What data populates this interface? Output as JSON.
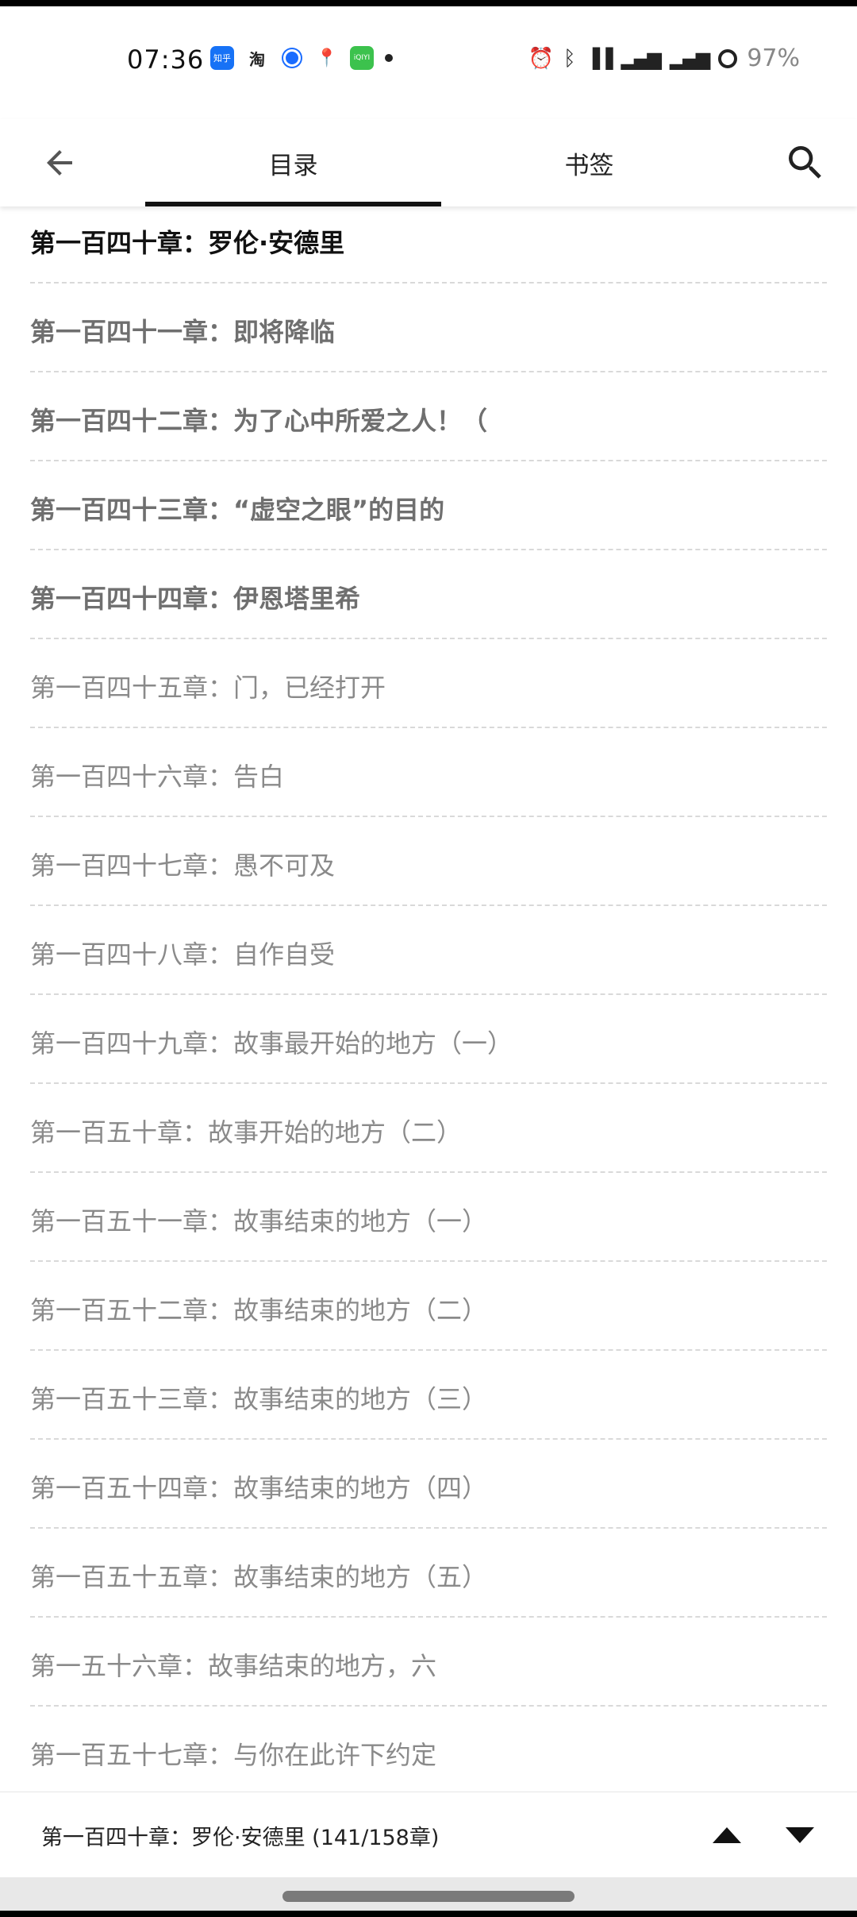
{
  "status_bar": {
    "time": "07:36",
    "notification_icons": [
      "zhihu-icon",
      "taobao-icon",
      "blue-circle-app-icon",
      "map-pin-icon",
      "iqiyi-icon"
    ],
    "zhihu_label": "知乎",
    "taobao_label": "淘",
    "iqiyi_label": "iQIYI",
    "battery": "97%"
  },
  "header": {
    "tabs": [
      {
        "label": "目录",
        "active": true
      },
      {
        "label": "书签",
        "active": false
      }
    ]
  },
  "chapters": [
    {
      "title": "第一百四十章：罗伦·安德里",
      "state": "current"
    },
    {
      "title": "第一百四十一章：即将降临",
      "state": "read"
    },
    {
      "title": "第一百四十二章：为了心中所爱之人！（",
      "state": "read"
    },
    {
      "title": "第一百四十三章：“虚空之眼”的目的",
      "state": "read"
    },
    {
      "title": "第一百四十四章：伊恩塔里希",
      "state": "read"
    },
    {
      "title": "第一百四十五章：门，已经打开",
      "state": "unread"
    },
    {
      "title": "第一百四十六章：告白",
      "state": "unread"
    },
    {
      "title": "第一百四十七章：愚不可及",
      "state": "unread"
    },
    {
      "title": "第一百四十八章：自作自受",
      "state": "unread"
    },
    {
      "title": "第一百四十九章：故事最开始的地方（一）",
      "state": "unread"
    },
    {
      "title": "第一百五十章：故事开始的地方（二）",
      "state": "unread"
    },
    {
      "title": "第一百五十一章：故事结束的地方（一）",
      "state": "unread"
    },
    {
      "title": "第一百五十二章：故事结束的地方（二）",
      "state": "unread"
    },
    {
      "title": "第一百五十三章：故事结束的地方（三）",
      "state": "unread"
    },
    {
      "title": "第一百五十四章：故事结束的地方（四）",
      "state": "unread"
    },
    {
      "title": "第一百五十五章：故事结束的地方（五）",
      "state": "unread"
    },
    {
      "title": "第一五十六章：故事结束的地方，六",
      "state": "unread"
    },
    {
      "title": "第一百五十七章：与你在此许下约定",
      "state": "unread"
    }
  ],
  "footer": {
    "current_chapter": "第一百四十章：罗伦·安德里 (141/158章)"
  },
  "colors": {
    "current_text": "#111111",
    "read_text": "#6f6f6f",
    "unread_text": "#8a8a8a",
    "divider": "#d9d9d9"
  }
}
